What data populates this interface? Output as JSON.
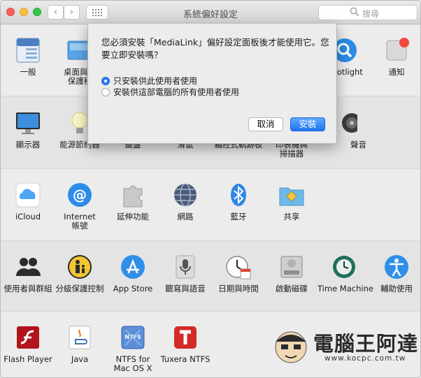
{
  "window": {
    "title": "系統偏好設定"
  },
  "search": {
    "placeholder": "搜尋"
  },
  "nav": {
    "back": "‹",
    "forward": "›"
  },
  "rows": [
    {
      "items": [
        {
          "label": "一般",
          "icon": "general-file-icon"
        },
        {
          "label": "桌面與螢\n保護程",
          "icon": "desktop-icon"
        },
        {
          "label": "Spotlight",
          "icon": "spotlight-icon"
        },
        {
          "label": "通知",
          "icon": "notifications-icon"
        }
      ]
    },
    {
      "items": [
        {
          "label": "顯示器",
          "icon": "display-icon"
        },
        {
          "label": "能源節約器",
          "icon": "energy-saver-icon"
        },
        {
          "label": "鍵盤",
          "icon": "keyboard-icon"
        },
        {
          "label": "滑鼠",
          "icon": "mouse-icon"
        },
        {
          "label": "觸控式軌跡板",
          "icon": "trackpad-icon"
        },
        {
          "label": "印表機與\n掃描器",
          "icon": "printer-icon"
        },
        {
          "label": "聲音",
          "icon": "sound-icon"
        }
      ]
    },
    {
      "items": [
        {
          "label": "iCloud",
          "icon": "icloud-icon"
        },
        {
          "label": "Internet\n帳號",
          "icon": "internet-accounts-icon"
        },
        {
          "label": "延伸功能",
          "icon": "extensions-icon"
        },
        {
          "label": "網路",
          "icon": "network-icon"
        },
        {
          "label": "藍牙",
          "icon": "bluetooth-icon"
        },
        {
          "label": "共享",
          "icon": "sharing-icon"
        }
      ]
    },
    {
      "items": [
        {
          "label": "使用者與群組",
          "icon": "users-groups-icon"
        },
        {
          "label": "分級保護控制",
          "icon": "parental-controls-icon"
        },
        {
          "label": "App Store",
          "icon": "app-store-icon"
        },
        {
          "label": "聽寫與語音",
          "icon": "dictation-icon"
        },
        {
          "label": "日期與時間",
          "icon": "date-time-icon"
        },
        {
          "label": "啟動磁碟",
          "icon": "startup-disk-icon"
        },
        {
          "label": "Time Machine",
          "icon": "time-machine-icon"
        },
        {
          "label": "輔助使用",
          "icon": "accessibility-icon"
        }
      ]
    },
    {
      "items": [
        {
          "label": "Flash Player",
          "icon": "flash-player-icon"
        },
        {
          "label": "Java",
          "icon": "java-icon"
        },
        {
          "label": "NTFS for\nMac OS X",
          "icon": "ntfs-icon"
        },
        {
          "label": "Tuxera NTFS",
          "icon": "tuxera-icon"
        }
      ]
    }
  ],
  "dialog": {
    "message": "您必須安裝「MediaLink」偏好設定面板後才能使用它。您要立即安裝嗎？",
    "option_current": "只安裝供此使用者使用",
    "option_all": "安裝供這部電腦的所有使用者使用",
    "cancel": "取消",
    "install": "安裝"
  },
  "watermark": {
    "name": "電腦王阿達",
    "url": "www.kocpc.com.tw"
  },
  "colors": {
    "accent": "#2f7bf5",
    "close": "#fc605c",
    "minimize": "#fdbc40",
    "zoom": "#34c84a"
  }
}
